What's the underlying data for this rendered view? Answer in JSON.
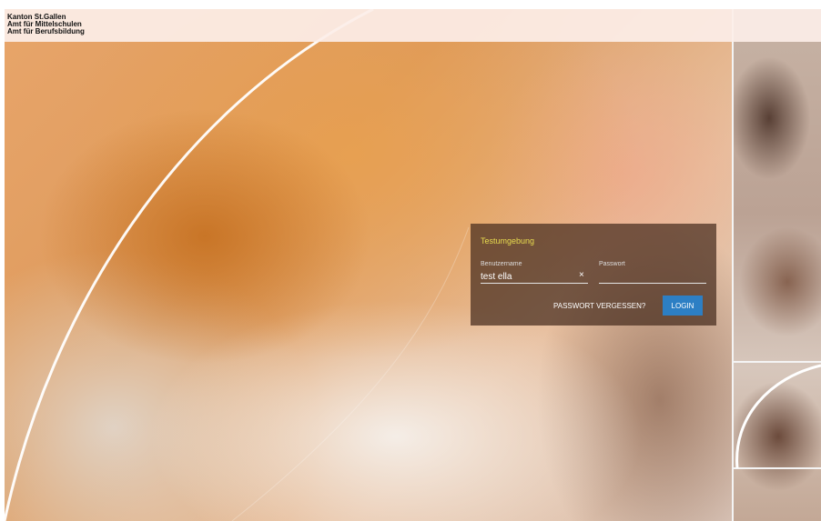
{
  "header": {
    "org_line1": "Kanton St.Gallen",
    "org_line2": "Amt für Mittelschulen",
    "org_line3": "Amt für Berufsbildung"
  },
  "login": {
    "environment_label": "Testumgebung",
    "username_label": "Benutzername",
    "username_value": "test ella",
    "password_label": "Passwort",
    "password_value": "",
    "clear_icon": "×",
    "forgot_password": "PASSWORT VERGESSEN?",
    "login_button": "LOGIN"
  },
  "colors": {
    "environment_label": "#e8dc4f",
    "login_button": "#2d7fc4"
  },
  "icons": {
    "clear": "close-icon"
  }
}
